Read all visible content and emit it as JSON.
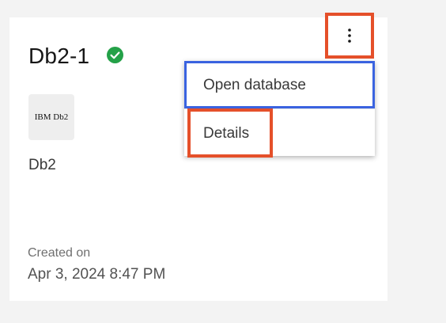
{
  "card": {
    "title": "Db2-1",
    "status": "active",
    "status_color": "#24a148",
    "logo_text": "IBM Db2",
    "type": "Db2",
    "created_label": "Created on",
    "created_value": "Apr 3, 2024 8:47 PM"
  },
  "overflow_menu": {
    "button_icon": "overflow-menu-vertical-icon",
    "items": [
      {
        "label": "Open database"
      },
      {
        "label": "Details"
      }
    ]
  },
  "colors": {
    "highlight": "#e5502a",
    "focus": "#3a63e0"
  }
}
